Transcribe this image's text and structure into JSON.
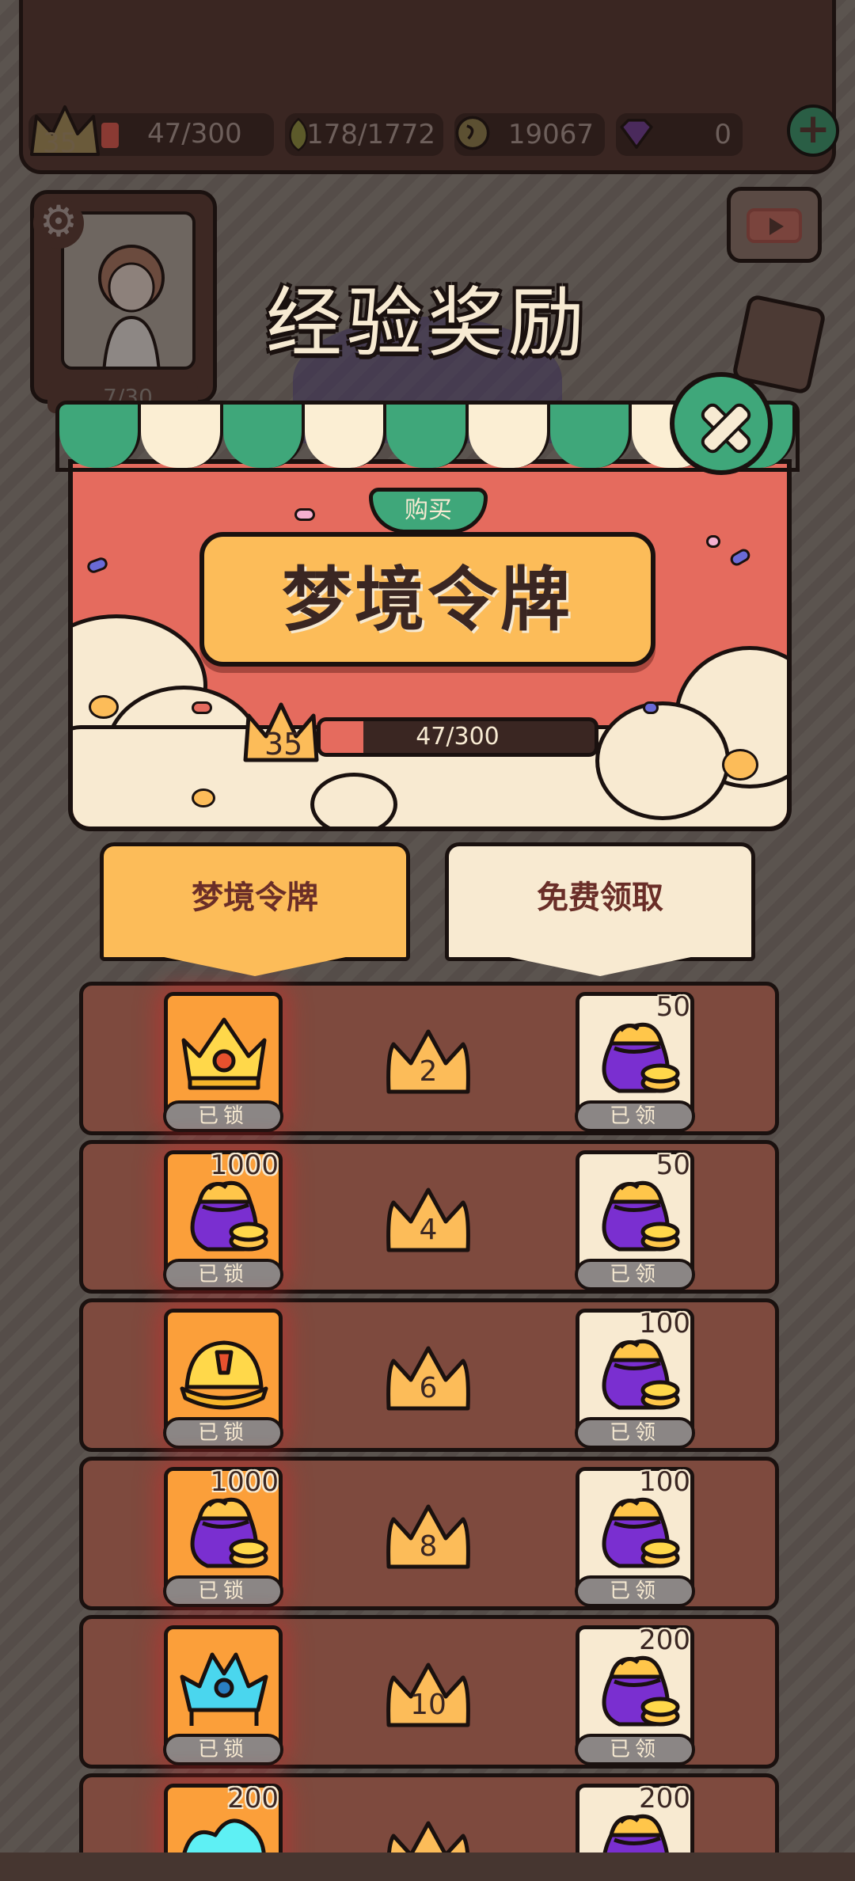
{
  "hud": {
    "level": "35",
    "xp": "47/300",
    "crops": "178/1772",
    "coins": "19067",
    "gems": "0"
  },
  "avatar": {
    "energy": "7/30"
  },
  "title": "经验奖励",
  "panel": {
    "buy_label": "购买",
    "token_name": "梦境令牌",
    "level": "35",
    "progress_text": "47/300",
    "progress_fraction": 0.157
  },
  "tabs": [
    {
      "label": "梦境令牌",
      "active": true
    },
    {
      "label": "免费领取",
      "active": false
    }
  ],
  "rewards": [
    {
      "level": "2",
      "paid": {
        "item": "gold-crown-icon",
        "amount": "",
        "state": "已锁"
      },
      "free": {
        "item": "coin-bag-icon",
        "amount": "50",
        "state": "已领"
      }
    },
    {
      "level": "4",
      "paid": {
        "item": "coin-bag-icon",
        "amount": "1000",
        "state": "已锁"
      },
      "free": {
        "item": "coin-bag-icon",
        "amount": "50",
        "state": "已领"
      }
    },
    {
      "level": "6",
      "paid": {
        "item": "yellow-hat-icon",
        "amount": "",
        "state": "已锁"
      },
      "free": {
        "item": "coin-bag-icon",
        "amount": "100",
        "state": "已领"
      }
    },
    {
      "level": "8",
      "paid": {
        "item": "coin-bag-icon",
        "amount": "1000",
        "state": "已锁"
      },
      "free": {
        "item": "coin-bag-icon",
        "amount": "100",
        "state": "已领"
      }
    },
    {
      "level": "10",
      "paid": {
        "item": "blue-crown-icon",
        "amount": "",
        "state": "已锁"
      },
      "free": {
        "item": "coin-bag-icon",
        "amount": "200",
        "state": "已领"
      }
    },
    {
      "level": "",
      "paid": {
        "item": "blue-item-icon",
        "amount": "200",
        "state": ""
      },
      "free": {
        "item": "coin-bag-icon",
        "amount": "200",
        "state": ""
      }
    }
  ],
  "colors": {
    "panel_red": "#e56b5e",
    "accent_green": "#3fa77a",
    "token_orange": "#fcbc59",
    "row_brown": "#7e4a3e",
    "cream": "#f8ead1"
  }
}
